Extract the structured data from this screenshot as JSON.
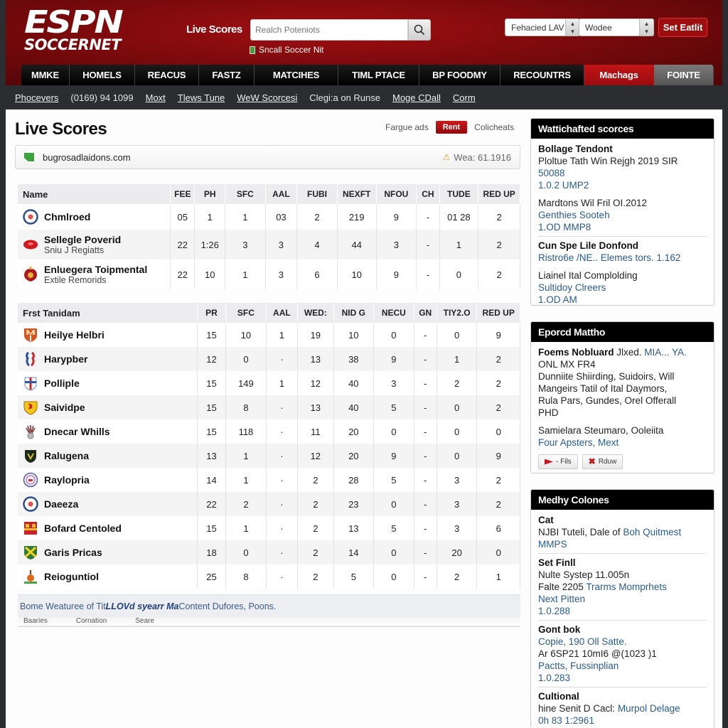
{
  "header": {
    "logo_top": "ESPN",
    "logo_bottom": "SOCCERNET",
    "live_scores_label": "Live Scores",
    "search_placeholder": "Realch Poteniots",
    "small_link": "Sncall Soccer Nit",
    "select1_value": "Fehacied LAV",
    "select2_value": "Wodee",
    "set_button": "Set Eatlit",
    "colors": {
      "brand_red": "#9c0d10",
      "nav_black": "#000000",
      "nav_active": "#c21518"
    }
  },
  "nav": {
    "items": [
      {
        "label": "MMKE"
      },
      {
        "label": "HOMELS"
      },
      {
        "label": "REACUS"
      },
      {
        "label": "FASTZ"
      },
      {
        "label": "MATCIHES"
      },
      {
        "label": "TIML PTACE"
      },
      {
        "label": "BP FOODMY"
      },
      {
        "label": "RECOUNTRS"
      },
      {
        "label": "Machags",
        "active": true
      },
      {
        "label": "FOINTE"
      }
    ]
  },
  "subbar": {
    "items": [
      {
        "label": "Phocevers",
        "link": true
      },
      {
        "label": "(0169) 94 1099",
        "link": false
      },
      {
        "label": "Moxt",
        "link": true
      },
      {
        "label": "Tlews Tune",
        "link": true
      },
      {
        "label": "WeW Scorcesi",
        "link": true
      },
      {
        "label": "Clegi:a on Runse",
        "link": false
      },
      {
        "label": "Moge CDall",
        "link": true
      },
      {
        "label": "Corm",
        "link": true
      }
    ]
  },
  "main": {
    "title": "Live Scores",
    "tools": {
      "left": "Fargue ads",
      "button": "Rent",
      "right": "Colicheats"
    },
    "url_bar": {
      "url": "bugrosadlaidons.com",
      "warning": "Wea: 61.1916"
    },
    "table1": {
      "headers": [
        "Name",
        "FEE",
        "PH",
        "SFC",
        "AAL",
        "FUBI",
        "NEXFT",
        "NFOU",
        "CH",
        "TUDE",
        "RED UP"
      ],
      "rows": [
        {
          "name": "Chmlroed",
          "sub": "",
          "crest": "round-blue-crest",
          "values": [
            "05",
            "1",
            "1",
            "03",
            "2",
            "219",
            "9",
            "-",
            "01 28",
            "2"
          ]
        },
        {
          "name": "Sellegle Poverid",
          "sub": "Sniu J Regiatts",
          "crest": "red-oval-crest",
          "values": [
            "22",
            "1:26",
            "3",
            "3",
            "4",
            "44",
            "3",
            "-",
            "1",
            "2"
          ]
        },
        {
          "name": "Enluegera Toipmental",
          "sub": "Extile Remorids",
          "crest": "red-shield-crest",
          "values": [
            "22",
            "10",
            "1",
            "3",
            "6",
            "10",
            "9",
            "-",
            "0",
            "2"
          ]
        }
      ]
    },
    "table2": {
      "headers": [
        "Frst Tanidam",
        "PR",
        "SFC",
        "AAL",
        "WED:",
        "NID G",
        "NECU",
        "GN",
        "TIY2.O",
        "RED UP"
      ],
      "rows": [
        {
          "name": "Heilye Helbri",
          "crest": "orange-shield-crest",
          "values": [
            "15",
            "10",
            "1",
            "19",
            "10",
            "0",
            "-",
            "0",
            "9"
          ]
        },
        {
          "name": "Harypber",
          "crest": "blue-red-figure-crest",
          "values": [
            "12",
            "0",
            "·",
            "13",
            "38",
            "9",
            "-",
            "1",
            "2"
          ]
        },
        {
          "name": "Polliple",
          "crest": "white-cross-crest",
          "values": [
            "15",
            "149",
            "1",
            "12",
            "40",
            "3",
            "-",
            "2",
            "2"
          ]
        },
        {
          "name": "Saividpe",
          "crest": "yellow-lion-crest",
          "values": [
            "15",
            "8",
            "·",
            "13",
            "40",
            "5",
            "-",
            "0",
            "2"
          ]
        },
        {
          "name": "Dnecar Whills",
          "crest": "feather-crest",
          "values": [
            "15",
            "118",
            "·",
            "11",
            "20",
            "0",
            "-",
            "0",
            "0"
          ]
        },
        {
          "name": "Ralugena",
          "crest": "green-shield-crest",
          "values": [
            "13",
            "1",
            "·",
            "12",
            "20",
            "9",
            "-",
            "0",
            "9"
          ]
        },
        {
          "name": "Raylopria",
          "crest": "round-purple-crest",
          "values": [
            "14",
            "1",
            "·",
            "2",
            "28",
            "5",
            "-",
            "3",
            "2"
          ]
        },
        {
          "name": "Daeeza",
          "crest": "round-blue-crest",
          "values": [
            "22",
            "2",
            "·",
            "2",
            "23",
            "0",
            "-",
            "3",
            "2"
          ]
        },
        {
          "name": "Bofard Centoled",
          "crest": "red-yellow-square-crest",
          "values": [
            "15",
            "1",
            "·",
            "2",
            "13",
            "5",
            "-",
            "3",
            "6"
          ]
        },
        {
          "name": "Garis Pricas",
          "crest": "green-yellow-x-crest",
          "values": [
            "18",
            "0",
            "·",
            "2",
            "14",
            "0",
            "-",
            "20",
            "0"
          ]
        },
        {
          "name": "Reioguntiol",
          "crest": "orange-figure-crest",
          "values": [
            "25",
            "8",
            "·",
            "2",
            "5",
            "0",
            "-",
            "2",
            "1"
          ]
        }
      ]
    },
    "footer": {
      "text_before": "Bome Weaturee of Tit",
      "text_bold": "LLOVd syearr Ma",
      "text_after": " Content Dufores, Poons.",
      "sub_items": [
        "Baaries",
        "Cornation",
        "Seare"
      ]
    }
  },
  "sidebar": {
    "box1": {
      "title": "Wattichafted scorces",
      "groups": [
        {
          "title": "Bollage Tendont",
          "lines": [
            {
              "text": "Ploltue Tath Win Rejgh 2019 SIR",
              "link": false
            },
            {
              "text": "50088",
              "link": true
            },
            {
              "text": "1.0.2 UMP2",
              "link": true
            }
          ]
        },
        {
          "title": "",
          "lines": [
            {
              "text": "Mardtons Wil Fril OI.2012",
              "link": false
            },
            {
              "text": "Genthies Sooteh",
              "link": true
            },
            {
              "text": "1.OD MMP8",
              "link": true
            }
          ]
        },
        {
          "title": "Cun Spe Lile Donfond",
          "lines": [
            {
              "text": "Ristro6e /NE.. Elemes tors. 1.162",
              "link": true
            }
          ]
        },
        {
          "title": "",
          "lines": [
            {
              "text": "Liainel Ital Complolding",
              "link": false
            },
            {
              "text": "Sultidoy Clreers",
              "link": true
            },
            {
              "text": "1.OD AM",
              "link": true
            }
          ]
        }
      ]
    },
    "box2": {
      "title": "Eporcd Mattho",
      "lead_bold": "Foems Nobluard",
      "lead_text": " Jlxed. ",
      "lead_link": "MIA... YA.",
      "lines": [
        "ONL MX FR4",
        "Dunniite Shiirding, Suidoirs, Will",
        "Mangeirs Tatil of Ital Daymors,",
        "Rula Pars, Gundes, Orel Offerall",
        "PHD"
      ],
      "tail_text": "Samielara Steumaro, Ooleiita",
      "tail_link": "Four Apsters, Mext",
      "buttons": [
        {
          "label": "- Fils",
          "icon": "flag-icon"
        },
        {
          "label": "Rduw",
          "icon": "pin-icon"
        }
      ]
    },
    "box3": {
      "title": "Medhy Colones",
      "groups": [
        {
          "title": "Cat",
          "lines": [
            {
              "text": "NJBI Tuteli, Dale of ",
              "link": false,
              "link_text": "Boh Quitmest"
            },
            {
              "text": "MMPS",
              "link": true
            }
          ]
        },
        {
          "title": "Set Finll",
          "lines": [
            {
              "text": "Nulte Systep 11.005n",
              "link": false
            },
            {
              "text": "Falte 2205 ",
              "link": false,
              "link_text": "Trarms Momprhets"
            },
            {
              "text": "Next Pitten",
              "link": true
            },
            {
              "text": "1.0.288",
              "link": true
            }
          ]
        },
        {
          "title": "Gont bok",
          "lines": [
            {
              "text": "Copie, 190 Oll Satte.",
              "link": true
            },
            {
              "text": "Ar 6SP21 10mI6 @(1023 )1",
              "link": false
            },
            {
              "text": "Pactts, Fussinplian",
              "link": true
            },
            {
              "text": "1.0.283",
              "link": true
            }
          ]
        },
        {
          "title": "Cultional",
          "lines": [
            {
              "text": "hine Senit D Cacl: ",
              "link": false,
              "link_text": "Murpol Delage"
            },
            {
              "text": "0h 83 1:2961",
              "link": true
            }
          ]
        }
      ]
    }
  }
}
